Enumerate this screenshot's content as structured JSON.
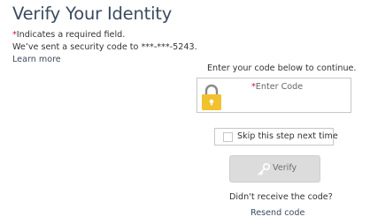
{
  "header": {
    "title": "Verify Your Identity"
  },
  "info": {
    "required_star": "*",
    "required_text": "Indicates a required field.",
    "sent_text": "We’ve sent a security code to ***-***-5243.",
    "learn_more": "Learn more"
  },
  "form": {
    "instruction": "Enter your code below to continue.",
    "code_field": {
      "required_star": "*",
      "placeholder": "Enter Code",
      "value": ""
    },
    "lock_icon": "lock-icon",
    "skip_label": "Skip this step next time",
    "skip_checked": false,
    "verify_button": {
      "label": "Verify",
      "icon": "key-icon",
      "enabled": false
    },
    "didnt_receive": "Didn't receive the code?",
    "resend_link": "Resend code"
  },
  "colors": {
    "title": "#3b4b5e",
    "required": "#c8102e",
    "lock": "#f2c12e",
    "button_disabled": "#dcdcdc"
  }
}
